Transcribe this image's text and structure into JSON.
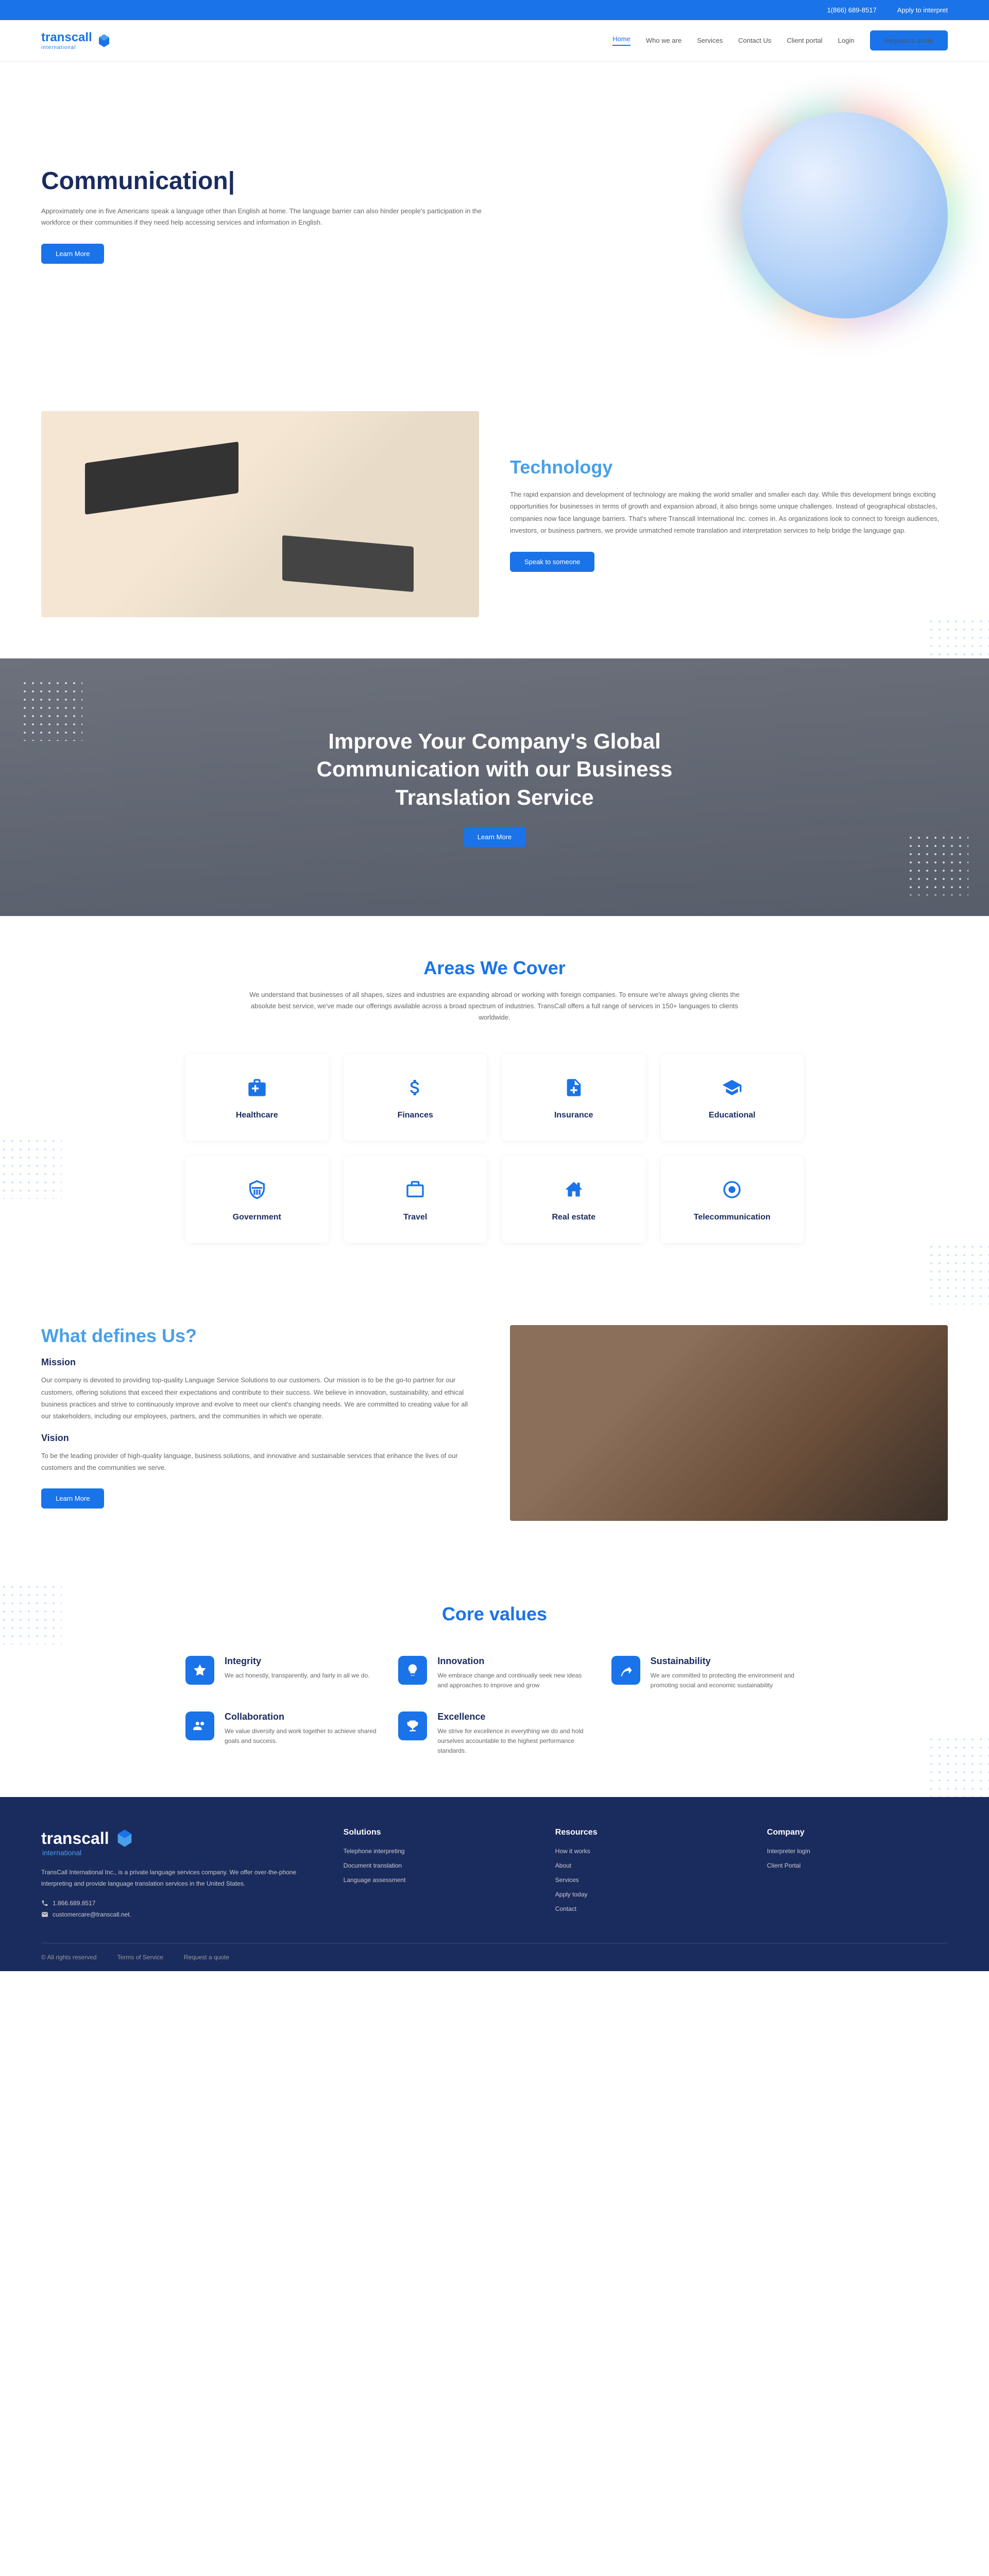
{
  "topbar": {
    "phone": "1(866) 689-8517",
    "apply": "Apply to interpret"
  },
  "header": {
    "logo": "transcall",
    "logo_sub": "international",
    "nav": [
      "Home",
      "Who we are",
      "Services",
      "Contact Us",
      "Client portal",
      "Login"
    ],
    "cta": "Request a quote"
  },
  "hero": {
    "title": "Communication|",
    "text": "Approximately one in five Americans speak a language other than English at home. The language barrier can also hinder people's participation in the workforce or their communities if they need help accessing services and information in English.",
    "btn": "Learn More"
  },
  "tech": {
    "title": "Technology",
    "text": "The rapid expansion and development of technology are making the world smaller and smaller each day. While this development brings exciting opportunities for businesses in terms of growth and expansion abroad, it also brings some unique challenges. Instead of geographical obstacles, companies now face language barriers. That's where Transcall International Inc. comes in. As organizations look to connect to foreign audiences, investors, or business partners, we provide unmatched remote translation and interpretation services to help bridge the language gap.",
    "btn": "Speak to someone"
  },
  "banner": {
    "title": "Improve Your Company's Global Communication with our Business Translation Service",
    "btn": "Learn More"
  },
  "areas": {
    "title": "Areas We Cover",
    "text": "We understand that businesses of all shapes, sizes and industries are expanding abroad or working with foreign companies. To ensure we're always giving clients the absolute best service, we've made our offerings available across a broad spectrum of industries. TransCall offers a full range of services in 150+ languages to clients worldwide.",
    "items": [
      "Healthcare",
      "Finances",
      "Insurance",
      "Educational",
      "Government",
      "Travel",
      "Real estate",
      "Telecommunication"
    ]
  },
  "defines": {
    "title": "What defines Us?",
    "mission_h": "Mission",
    "mission": "Our company is devoted to providing top-quality Language Service Solutions to our customers. Our mission is to be the go-to partner for our customers, offering solutions that exceed their expectations and contribute to their success. We believe in innovation, sustainability, and ethical business practices and strive to continuously improve and evolve to meet our client's changing needs. We are committed to creating value for all our stakeholders, including our employees, partners, and the communities in which we operate.",
    "vision_h": "Vision",
    "vision": "To be the leading provider of high-quality language, business solutions, and innovative and sustainable services that enhance the lives of our customers and the communities we serve.",
    "btn": "Learn More"
  },
  "values": {
    "title": "Core values",
    "items": [
      {
        "name": "Integrity",
        "desc": "We act honestly, transparently, and fairly in all we do."
      },
      {
        "name": "Innovation",
        "desc": "We embrace change and continually seek new ideas and approaches to improve and grow"
      },
      {
        "name": "Sustainability",
        "desc": "We are committed to protecting the environment and promoting social and economic sustainability"
      },
      {
        "name": "Collaboration",
        "desc": "We value diversity and work together to achieve shared goals and success."
      },
      {
        "name": "Excellence",
        "desc": "We strive for excellence in everything we do and hold ourselves accountable to the highest performance standards."
      }
    ]
  },
  "footer": {
    "logo": "transcall",
    "logo_sub": "international",
    "desc": "TransCall International Inc., is a private language services company. We offer over-the-phone interpreting and provide language translation services in the United States.",
    "phone": "1.866.689.8517",
    "email": "customercare@transcall.net.",
    "cols": [
      {
        "title": "Solutions",
        "links": [
          "Telephone interpreting",
          "Document translation",
          "Language assessment"
        ]
      },
      {
        "title": "Resources",
        "links": [
          "How it works",
          "About",
          "Services",
          "Apply today",
          "Contact"
        ]
      },
      {
        "title": "Company",
        "links": [
          "Interpreter login",
          "Client Portal"
        ]
      }
    ],
    "bottom": [
      "© All rights reserved",
      "Terms of Service",
      "Request a quote"
    ]
  }
}
